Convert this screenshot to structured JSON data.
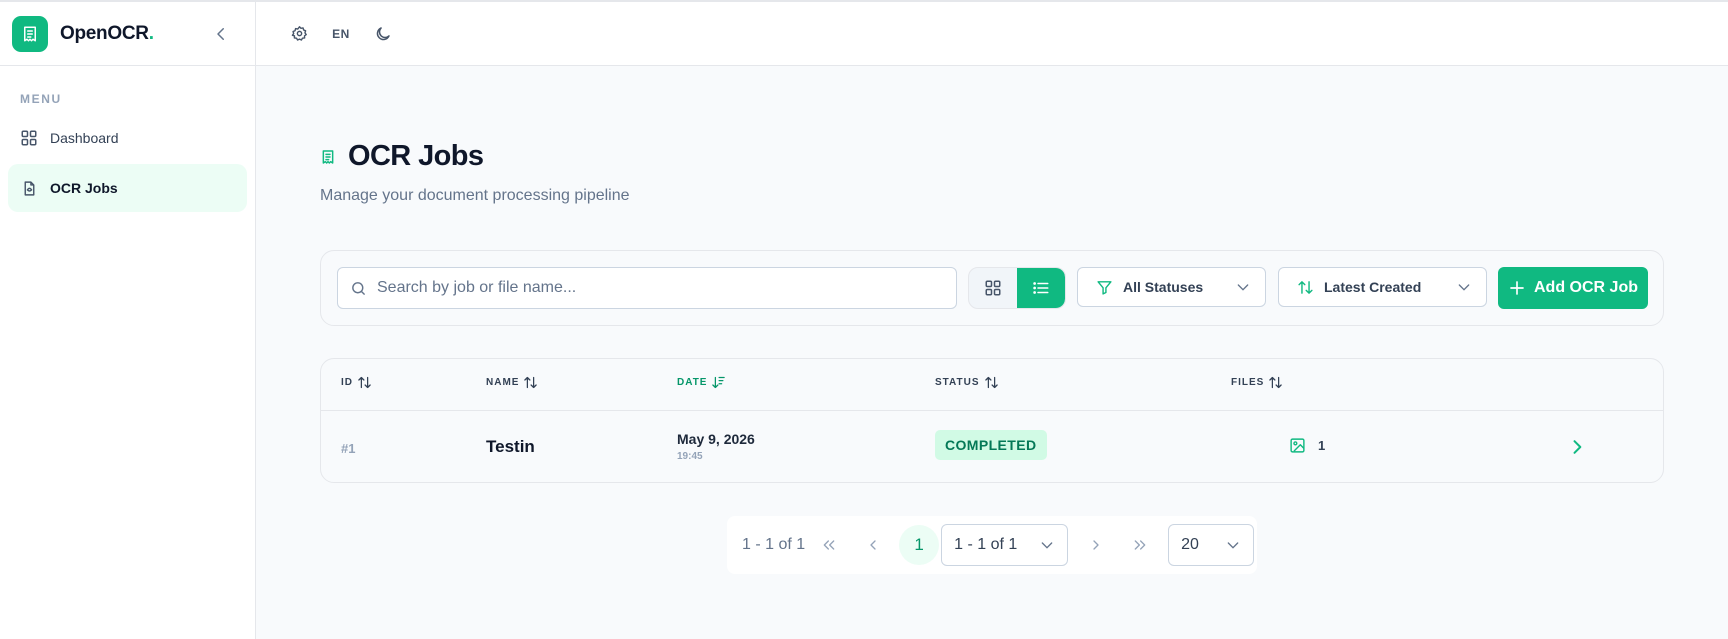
{
  "app": {
    "name": "OpenOCR",
    "name_dot": ".",
    "accent": "#10b981"
  },
  "sidebar": {
    "menu_label": "MENU",
    "items": [
      {
        "label": "Dashboard",
        "icon": "grid-icon",
        "active": false
      },
      {
        "label": "OCR Jobs",
        "icon": "file-icon",
        "active": true
      }
    ]
  },
  "header": {
    "language": "EN",
    "icons": [
      "gear-icon",
      "moon-icon"
    ]
  },
  "page": {
    "title": "OCR Jobs",
    "subtitle": "Manage your document processing pipeline"
  },
  "toolbar": {
    "search_placeholder": "Search by job or file name...",
    "search_value": "",
    "view_mode": "list",
    "status_filter": "All Statuses",
    "sort": "Latest Created",
    "add_label": "Add OCR Job"
  },
  "table": {
    "columns": [
      "ID",
      "NAME",
      "DATE",
      "STATUS",
      "FILES"
    ],
    "sorted_column": "DATE",
    "rows": [
      {
        "id": "#1",
        "name": "Testin",
        "date": "May 9, 2026",
        "time": "19:45",
        "status": "COMPLETED",
        "files": "1"
      }
    ]
  },
  "pagination": {
    "range_text": "1 - 1 of 1",
    "current_page": "1",
    "page_select": "1 - 1 of 1",
    "page_size": "20"
  }
}
